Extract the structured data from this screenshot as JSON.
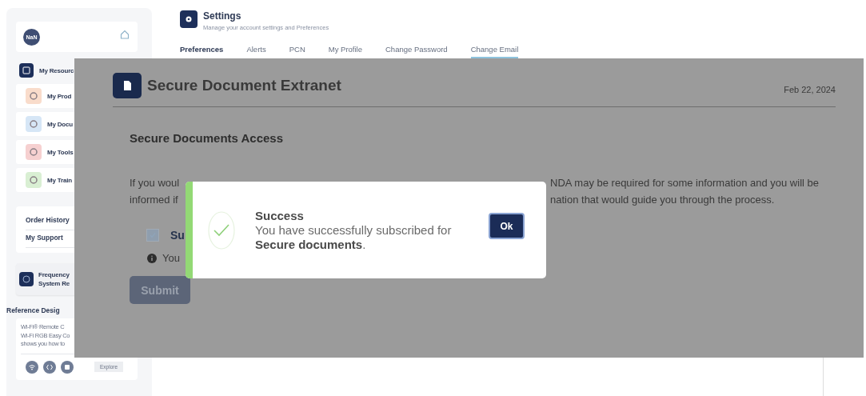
{
  "sidebar": {
    "avatar": "NaN",
    "resources": {
      "title": "My Resourc",
      "items": [
        {
          "label": "My Prod",
          "color": "#f9dccb"
        },
        {
          "label": "My Docu",
          "color": "#d6e6f6"
        },
        {
          "label": "My Tools",
          "color": "#f6d0d0"
        },
        {
          "label": "My Train",
          "color": "#d9efd3"
        }
      ]
    },
    "links": [
      "Order History",
      "My Support"
    ],
    "frequency": [
      "Frequency",
      "System Re"
    ],
    "reference": {
      "title": "Reference Desig",
      "lines": [
        "Wi-Fi® Remote C",
        "Wi-Fi RGB Easy Co",
        "shows you how to"
      ],
      "button": "Explore"
    }
  },
  "settings": {
    "title": "Settings",
    "subtitle": "Manage your account settings and Preferences",
    "section": "Preferences",
    "tabs": [
      {
        "label": "Alerts",
        "selected": false
      },
      {
        "label": "PCN",
        "selected": false
      },
      {
        "label": "My Profile",
        "selected": false
      },
      {
        "label": "Change Password",
        "selected": false
      },
      {
        "label": "Change Email",
        "selected": true
      }
    ]
  },
  "extranet": {
    "title": "Secure Document Extranet",
    "date": "Feb 22, 2024",
    "heading": "Secure Documents Access",
    "paragraph": [
      {
        "left": "If you woul",
        "right": "NDA may be required for some information and you will be"
      },
      {
        "left": "informed if",
        "right": "nation that would guide you through the process."
      }
    ],
    "checkbox": {
      "label": "Su",
      "checked": true
    },
    "info": "You",
    "submit": "Submit"
  },
  "dialog": {
    "title": "Success",
    "message": "You have successfully subscribed for",
    "message_bold": "**Secure documents**.",
    "ok": "Ok"
  }
}
